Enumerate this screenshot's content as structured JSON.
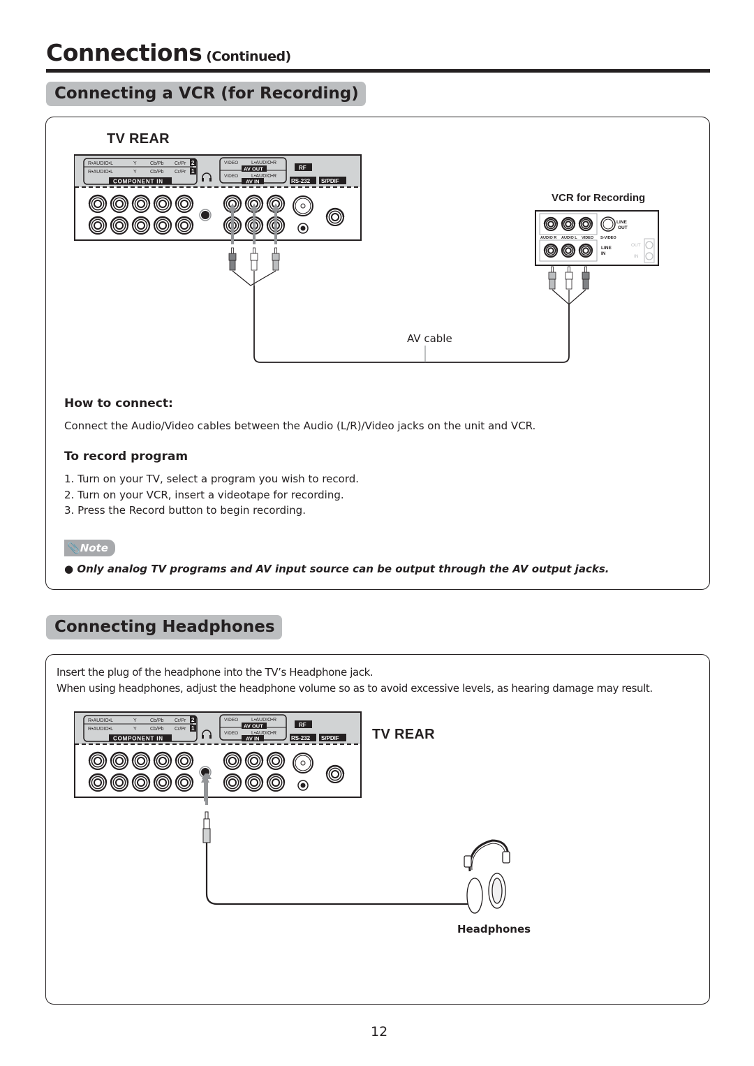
{
  "header": {
    "title": "Connections",
    "subtitle": "(Continued)"
  },
  "vcr_section": {
    "heading": "Connecting a VCR (for Recording)",
    "tv_rear_label": "TV REAR",
    "vcr_label": "VCR for Recording",
    "cable_label": "AV cable",
    "panel": {
      "component_rows": [
        {
          "audio": "R•AUDIO•L",
          "y": "Y",
          "cb": "Cb/Pb",
          "cr": "Cr/Pr",
          "num": "2"
        },
        {
          "audio": "R•AUDIO•L",
          "y": "Y",
          "cb": "Cb/Pb",
          "cr": "Cr/Pr",
          "num": "1"
        }
      ],
      "component_in": "COMPONENT IN",
      "av_video": "VIDEO",
      "av_audio": "L•AUDIO•R",
      "av_out": "AV OUT",
      "av_in": "AV IN",
      "rf": "RF",
      "rs232": "RS-232",
      "spdif": "S/PDIF"
    },
    "vcr_panel": {
      "audio_r": "AUDIO R",
      "audio_l": "AUDIO L",
      "video": "VIDEO",
      "s_video": "S-VIDEO",
      "line_out": [
        "LINE",
        "OUT"
      ],
      "line_in": [
        "LINE",
        "IN"
      ],
      "rf_out": "OUT",
      "rf_in": "IN"
    },
    "how_to_connect": {
      "heading": "How to connect:",
      "text": "Connect the Audio/Video cables between the Audio (L/R)/Video jacks on the unit and VCR."
    },
    "to_record": {
      "heading": "To record program",
      "steps": [
        "1. Turn on your TV, select a program you wish to record.",
        "2. Turn on your VCR, insert a videotape for recording.",
        "3. Press the Record button to begin recording."
      ]
    },
    "note": {
      "label": "Note",
      "icon": "paperclip-icon",
      "text": "Only analog TV programs and AV input source can be output through the AV output jacks."
    }
  },
  "headphones_section": {
    "heading": "Connecting Headphones",
    "line1": "Insert the plug of the headphone into the TV’s Headphone jack.",
    "line2": "When using headphones, adjust the headphone volume so as to avoid excessive levels, as hearing damage may result.",
    "tv_rear_label": "TV REAR",
    "headphones_label": "Headphones"
  },
  "footer": {
    "page_number": "12"
  }
}
